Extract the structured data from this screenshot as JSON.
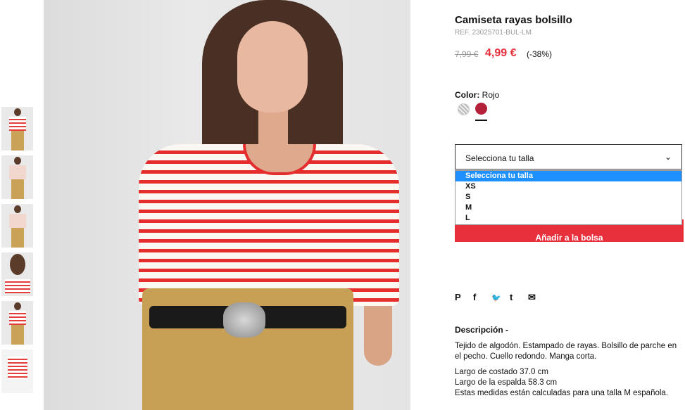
{
  "product": {
    "title": "Camiseta rayas bolsillo",
    "ref": "REF. 23025701-BUL-LM",
    "old_price": "7,99 €",
    "new_price": "4,99 €",
    "discount": "(-38%)"
  },
  "color": {
    "label": "Color:",
    "value": "Rojo"
  },
  "size_select": {
    "label": "Selecciona tu talla",
    "options": [
      "Selecciona tu talla",
      "XS",
      "S",
      "M",
      "L"
    ]
  },
  "add_button": "Añadir a la bolsa",
  "share_icons": [
    "P",
    "f",
    "🐦",
    "t",
    "✉"
  ],
  "description": {
    "heading": "Descripción -",
    "text": "Tejido de algodón. Estampado de rayas. Bolsillo de parche en el pecho. Cuello redondo. Manga corta.",
    "measures": [
      "Largo de costado 37.0 cm",
      "Largo de la espalda 58.3 cm",
      "Estas medidas están calculadas para una talla M española."
    ]
  },
  "colors": {
    "accent": "#e8303c",
    "selected_option": "#1e90ff"
  }
}
